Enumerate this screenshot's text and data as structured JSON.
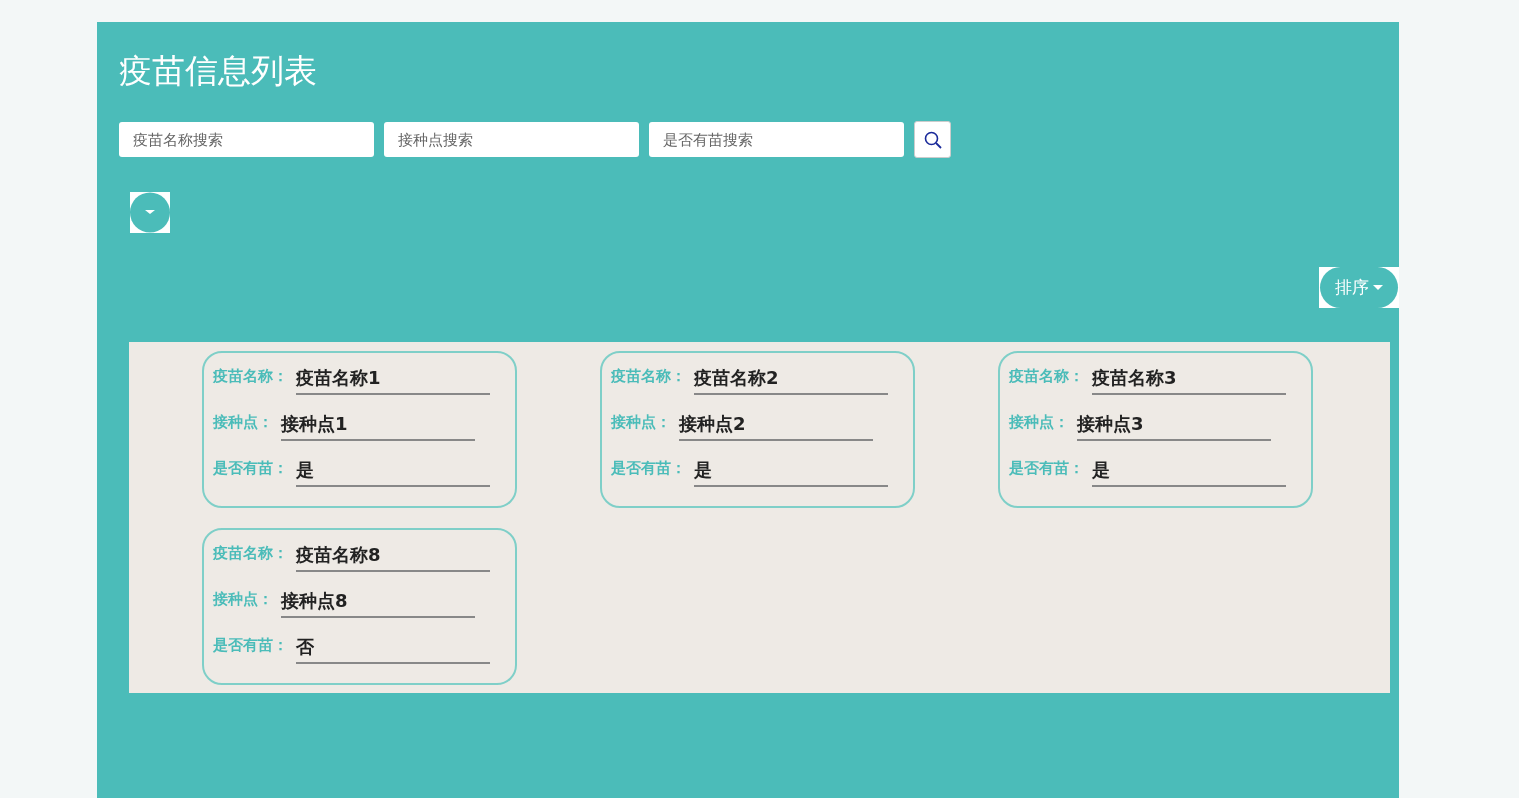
{
  "title": "疫苗信息列表",
  "search_fields": [
    {
      "placeholder": "疫苗名称搜索"
    },
    {
      "placeholder": "接种点搜索"
    },
    {
      "placeholder": "是否有苗搜索"
    }
  ],
  "sort_button": {
    "label": "排序"
  },
  "cards": [
    {
      "fields": [
        {
          "label": "疫苗名称：",
          "value": "疫苗名称1"
        },
        {
          "label": "接种点：",
          "value": "接种点1"
        },
        {
          "label": "是否有苗：",
          "value": "是"
        }
      ]
    },
    {
      "fields": [
        {
          "label": "疫苗名称：",
          "value": "疫苗名称2"
        },
        {
          "label": "接种点：",
          "value": "接种点2"
        },
        {
          "label": "是否有苗：",
          "value": "是"
        }
      ]
    },
    {
      "fields": [
        {
          "label": "疫苗名称：",
          "value": "疫苗名称3"
        },
        {
          "label": "接种点：",
          "value": "接种点3"
        },
        {
          "label": "是否有苗：",
          "value": "是"
        }
      ]
    },
    {
      "fields": [
        {
          "label": "疫苗名称：",
          "value": "疫苗名称8"
        },
        {
          "label": "接种点：",
          "value": "接种点8"
        },
        {
          "label": "是否有苗：",
          "value": "否"
        }
      ]
    }
  ]
}
